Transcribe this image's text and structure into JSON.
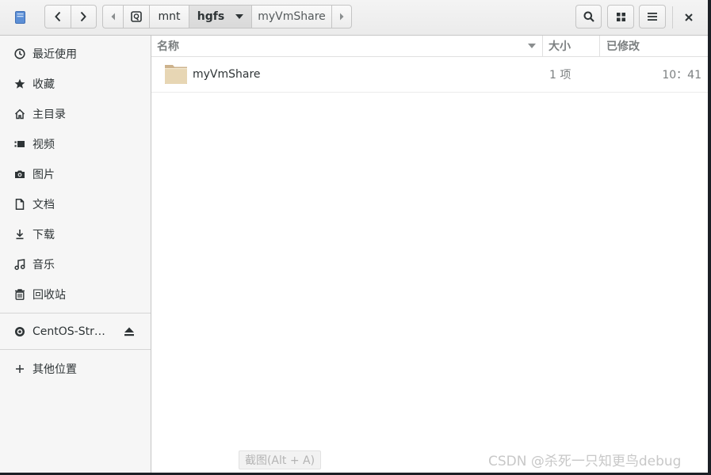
{
  "header": {
    "path": [
      "mnt",
      "hgfs",
      "myVmShare"
    ],
    "active_segment": "hgfs"
  },
  "sidebar": {
    "places": [
      {
        "label": "最近使用",
        "icon": "recent-icon"
      },
      {
        "label": "收藏",
        "icon": "star-icon"
      },
      {
        "label": "主目录",
        "icon": "home-icon"
      },
      {
        "label": "视频",
        "icon": "video-icon"
      },
      {
        "label": "图片",
        "icon": "camera-icon"
      },
      {
        "label": "文档",
        "icon": "document-icon"
      },
      {
        "label": "下载",
        "icon": "download-icon"
      },
      {
        "label": "音乐",
        "icon": "music-icon"
      },
      {
        "label": "回收站",
        "icon": "trash-icon"
      }
    ],
    "devices": [
      {
        "label": "CentOS-Str…",
        "icon": "disc-icon"
      }
    ],
    "other": {
      "label": "其他位置",
      "icon": "plus-icon"
    }
  },
  "columns": {
    "name": "名称",
    "size": "大小",
    "modified": "已修改"
  },
  "files": [
    {
      "name": "myVmShare",
      "size": "1 项",
      "modified": "10：41"
    }
  ],
  "tooltip": "截图(Alt + A)",
  "watermark": "CSDN @杀死一只知更鸟debug"
}
